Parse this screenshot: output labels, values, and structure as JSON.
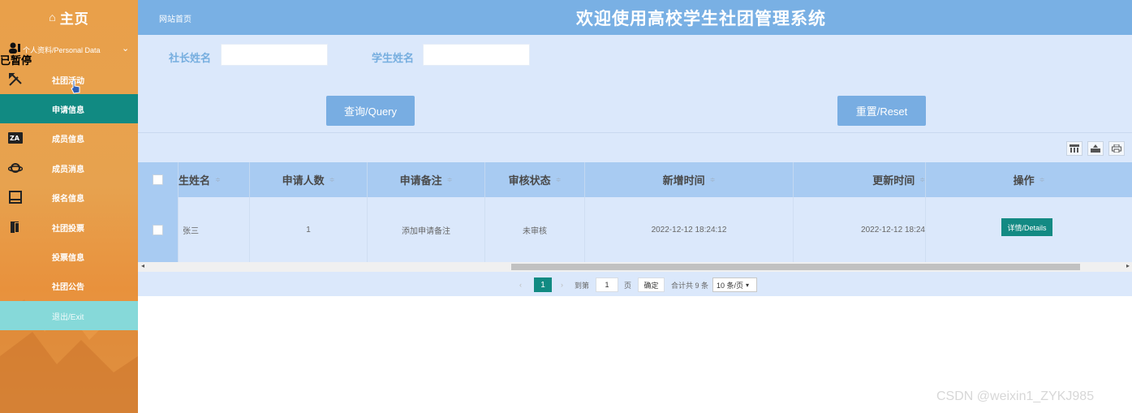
{
  "sidebar": {
    "home_label": "主页",
    "home_icon": "home-icon",
    "personal_label": "个人资料/Personal Data",
    "paused_label": "已暂停",
    "items": [
      {
        "label": "社团活动",
        "icon": "edit-tools-icon"
      },
      {
        "label": "申请信息",
        "icon": "",
        "active": true
      },
      {
        "label": "成员信息",
        "icon": "translate-icon"
      },
      {
        "label": "成员消息",
        "icon": "planet-icon"
      },
      {
        "label": "报名信息",
        "icon": "book-icon"
      },
      {
        "label": "社团投票",
        "icon": "door-icon"
      },
      {
        "label": "投票信息",
        "icon": ""
      },
      {
        "label": "社团公告",
        "icon": ""
      }
    ],
    "exit_label": "退出/Exit",
    "colors": {
      "background": "#e9a04a",
      "active": "#118a82",
      "exit": "#86d9d9"
    }
  },
  "header": {
    "home_link": "网站首页",
    "title": "欢迎使用高校学生社团管理系统",
    "color": "#79b0e4"
  },
  "search": {
    "field1_label": "社长姓名",
    "field1_value": "",
    "field2_label": "学生姓名",
    "field2_value": "",
    "query_label": "查询/Query",
    "reset_label": "重置/Reset"
  },
  "table": {
    "columns": [
      "生姓名",
      "申请人数",
      "申请备注",
      "审核状态",
      "新增时间",
      "更新时间",
      "操作"
    ],
    "sort_glyph": "≑",
    "rows": [
      {
        "name": "张三",
        "count": "1",
        "remark": "添加申请备注",
        "status": "未审核",
        "created": "2022-12-12 18:24:12",
        "updated": "2022-12-12 18:24",
        "action": "详情/Details"
      }
    ]
  },
  "pagination": {
    "prev": "‹",
    "current_page": "1",
    "next": "›",
    "goto_label": "到第",
    "goto_value": "1",
    "page_unit": "页",
    "confirm_label": "确定",
    "total_label": "合计共 9 条",
    "page_size": "10 条/页"
  },
  "watermark": "CSDN @weixin1_ZYKJ985"
}
